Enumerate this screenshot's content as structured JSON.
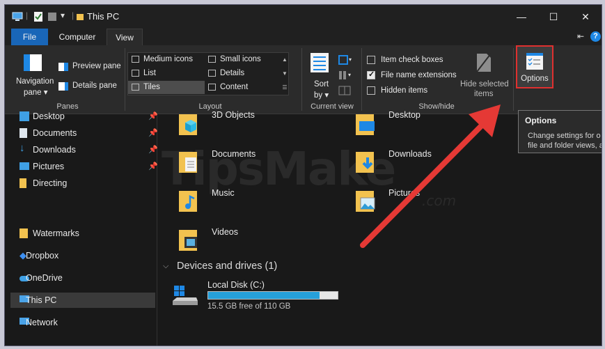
{
  "window": {
    "title": "This PC",
    "quick_access_dropdown": "▾",
    "minimize": "—",
    "maximize": "☐",
    "close": "✕"
  },
  "tabs": [
    {
      "label": "File"
    },
    {
      "label": "Computer"
    },
    {
      "label": "View"
    }
  ],
  "ribbon": {
    "collapse_icon": "⇤",
    "help_icon": "?",
    "panes": {
      "group_label": "Panes",
      "navigation_pane": "Navigation",
      "navigation_pane_2": "pane ▾",
      "preview_pane": "Preview pane",
      "details_pane": "Details pane"
    },
    "layout": {
      "group_label": "Layout",
      "items": [
        {
          "label": "Medium icons"
        },
        {
          "label": "Small icons"
        },
        {
          "label": "List"
        },
        {
          "label": "Details"
        },
        {
          "label": "Tiles"
        },
        {
          "label": "Content"
        }
      ]
    },
    "current_view": {
      "group_label": "Current view",
      "sort_by": "Sort",
      "sort_by_2": "by ▾"
    },
    "show_hide": {
      "group_label": "Show/hide",
      "item_check_boxes": {
        "label": "Item check boxes",
        "checked": false
      },
      "file_name_extensions": {
        "label": "File name extensions",
        "checked": true
      },
      "hidden_items": {
        "label": "Hidden items",
        "checked": false
      },
      "hide_selected": "Hide selected",
      "hide_selected_2": "items"
    },
    "options": {
      "label": "Options"
    }
  },
  "tooltip": {
    "title": "Options",
    "line1": "Change settings for o",
    "line2": "file and folder views, a"
  },
  "nav": {
    "items": [
      {
        "label": "Desktop",
        "pinned": true
      },
      {
        "label": "Documents",
        "pinned": true
      },
      {
        "label": "Downloads",
        "pinned": true
      },
      {
        "label": "Pictures",
        "pinned": true
      },
      {
        "label": "Directing",
        "pinned": false
      },
      {
        "label": "Watermarks",
        "pinned": false
      },
      {
        "label": "Dropbox",
        "pinned": false
      },
      {
        "label": "OneDrive",
        "pinned": false
      },
      {
        "label": "This PC",
        "pinned": false,
        "selected": true
      },
      {
        "label": "Network",
        "pinned": false
      }
    ],
    "pin_glyph": "📌"
  },
  "content": {
    "folders": [
      {
        "label": "3D Objects"
      },
      {
        "label": "Desktop"
      },
      {
        "label": "Documents"
      },
      {
        "label": "Downloads"
      },
      {
        "label": "Music"
      },
      {
        "label": "Pictures"
      },
      {
        "label": "Videos"
      }
    ],
    "devices_header": "Devices and drives (1)",
    "drive": {
      "name": "Local Disk (C:)",
      "free_text": "15.5 GB free of 110 GB",
      "used_fraction": 0.86
    }
  },
  "watermark": {
    "text": "TipsMake",
    "domain": ".com"
  },
  "colors": {
    "accent": "#1966b8",
    "highlight": "#e0302f",
    "arrow": "#e53935",
    "drive_bar": "#26a0da",
    "folder": "#f2c24f"
  }
}
